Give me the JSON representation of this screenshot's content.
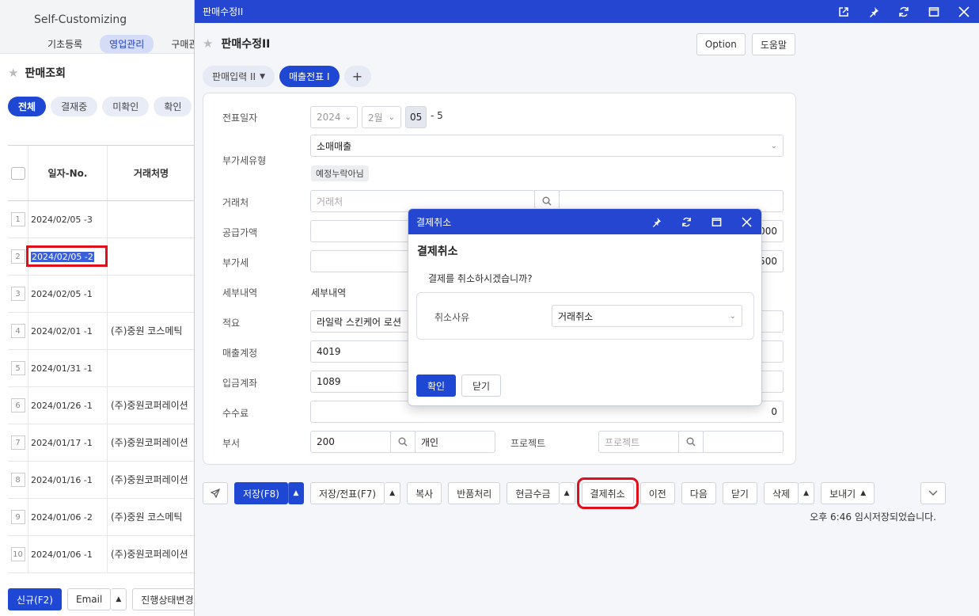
{
  "background": {
    "app_title": "Self-Customizing",
    "tabs": [
      "기초등록",
      "영업관리",
      "구매관"
    ],
    "page_title": "판매조회",
    "filters": [
      "전체",
      "결재중",
      "미확인",
      "확인"
    ],
    "table": {
      "headers": [
        "일자-No.",
        "거래처명"
      ],
      "rows": [
        {
          "num": "1",
          "date": "2024/02/05 -3",
          "name": ""
        },
        {
          "num": "2",
          "date": "2024/02/05 -2",
          "name": ""
        },
        {
          "num": "3",
          "date": "2024/02/05 -1",
          "name": ""
        },
        {
          "num": "4",
          "date": "2024/02/01 -1",
          "name": "(주)중원 코스메틱"
        },
        {
          "num": "5",
          "date": "2024/01/31 -1",
          "name": ""
        },
        {
          "num": "6",
          "date": "2024/01/26 -1",
          "name": "(주)중원코퍼레이션"
        },
        {
          "num": "7",
          "date": "2024/01/17 -1",
          "name": "(주)중원코퍼레이션"
        },
        {
          "num": "8",
          "date": "2024/01/16 -1",
          "name": "(주)중원코퍼레이션"
        },
        {
          "num": "9",
          "date": "2024/01/06 -2",
          "name": "(주)중원 코스메틱"
        },
        {
          "num": "10",
          "date": "2024/01/06 -1",
          "name": "(주)중원코퍼레이션"
        }
      ]
    },
    "bottom_buttons": {
      "new": "신규(F2)",
      "email": "Email",
      "status": "진행상태변경"
    }
  },
  "window": {
    "title": "판매수정II",
    "heading": "판매수정II",
    "option_label": "Option",
    "help_label": "도움말",
    "tabs": {
      "input": "판매입력 II",
      "slip": "매출전표 I",
      "add": "+"
    },
    "form": {
      "date_label": "전표일자",
      "year": "2024",
      "month": "2월",
      "day": "05",
      "seq": "- 5",
      "vat_type_label": "부가세유형",
      "vat_type_value": "소매매출",
      "vat_badge": "예정누락아님",
      "customer_label": "거래처",
      "customer_placeholder": "거래처",
      "supply_label": "공급가액",
      "supply_value_tail": "000",
      "tax_label": "부가세",
      "tax_value_tail": "500",
      "detail_label": "세부내역",
      "detail_value": "세부내역",
      "summary_label": "적요",
      "summary_value": "라일락 스킨케어 로션",
      "sales_account_label": "매출계정",
      "sales_account_value": "4019",
      "deposit_account_label": "입금계좌",
      "deposit_account_value": "1089",
      "fee_label": "수수료",
      "fee_value": "0",
      "dept_label": "부서",
      "dept_code": "200",
      "dept_name": "개인",
      "project_label": "프로젝트",
      "project_placeholder": "프로젝트"
    },
    "buttons": {
      "save": "저장(F8)",
      "save_slip": "저장/전표(F7)",
      "copy": "복사",
      "return": "반품처리",
      "cash": "현금수금",
      "cancel_payment": "결제취소",
      "prev": "이전",
      "next": "다음",
      "close": "닫기",
      "delete": "삭제",
      "export": "보내기"
    },
    "status_text": "오후 6:46 임시저장되었습니다."
  },
  "dialog": {
    "title": "결제취소",
    "heading": "결제취소",
    "message": "결제를 취소하시겠습니까?",
    "reason_label": "취소사유",
    "reason_value": "거래취소",
    "confirm": "확인",
    "close": "닫기"
  },
  "colors": {
    "primary": "#1e47d3",
    "titlebar": "#2446d1",
    "highlight": "#e0101a"
  }
}
